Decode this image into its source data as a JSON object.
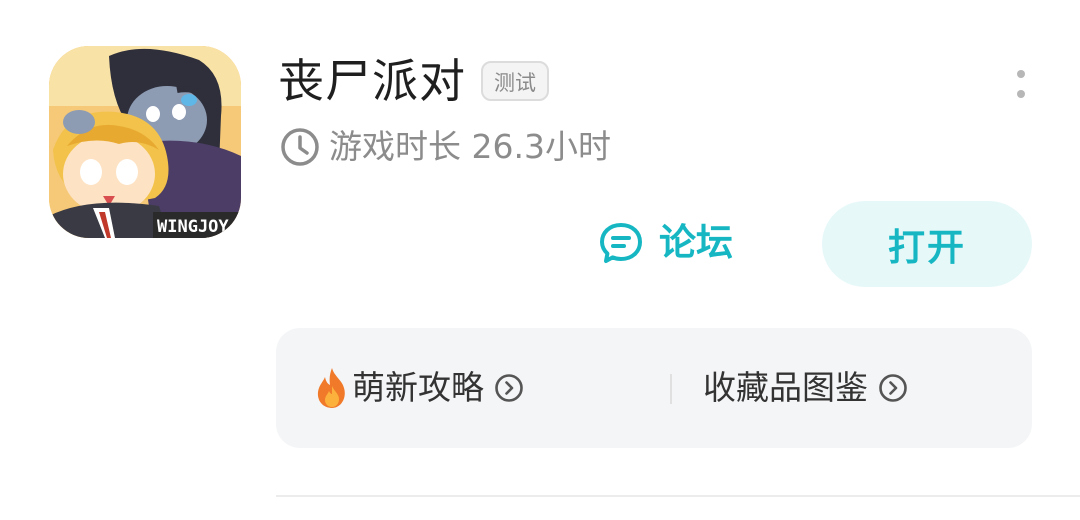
{
  "game": {
    "title": "丧尸派对",
    "badge": "测试",
    "playtime_text": "游戏时长 26.3小时",
    "icon_watermark": "WINGJOY"
  },
  "actions": {
    "forum_label": "论坛",
    "open_label": "打开"
  },
  "quick_links": [
    {
      "label": "萌新攻略",
      "icon": "fire-icon"
    },
    {
      "label": "收藏品图鉴",
      "icon": ""
    }
  ],
  "colors": {
    "accent": "#16b7c3",
    "open_button_bg": "#e7f8f9",
    "card_bg": "#f4f5f7",
    "muted_text": "#8c8c8c",
    "title_text": "#1f1f1f"
  }
}
